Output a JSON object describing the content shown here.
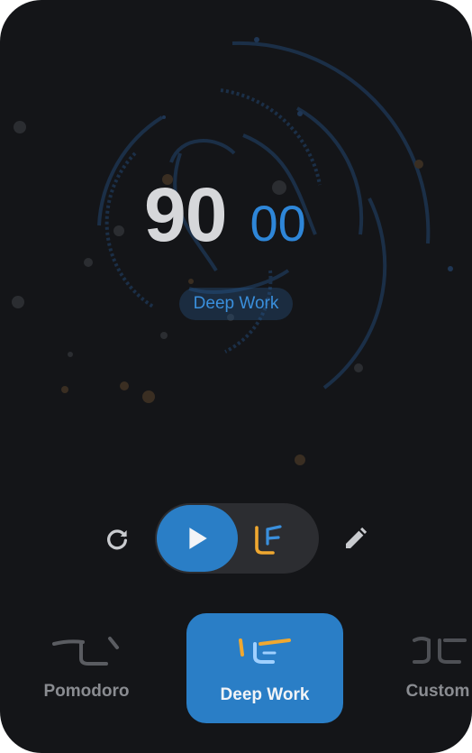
{
  "timer": {
    "minutes": "90",
    "seconds": "00",
    "mode_label": "Deep Work"
  },
  "controls": {
    "play_icon": "play-icon",
    "reset_icon": "refresh-icon",
    "edit_icon": "pencil-icon",
    "mode_icon": "deep-work-glyph-icon"
  },
  "presets": [
    {
      "label": "Pomodoro",
      "selected": false,
      "icon": "pomodoro-glyph-icon"
    },
    {
      "label": "Deep Work",
      "selected": true,
      "icon": "deep-work-glyph-icon"
    },
    {
      "label": "Custom",
      "selected": false,
      "icon": "custom-glyph-icon"
    }
  ],
  "colors": {
    "background": "#141518",
    "accent_blue": "#2a7ec6",
    "accent_orange": "#f0a830",
    "minutes_text": "#d6d7da"
  }
}
